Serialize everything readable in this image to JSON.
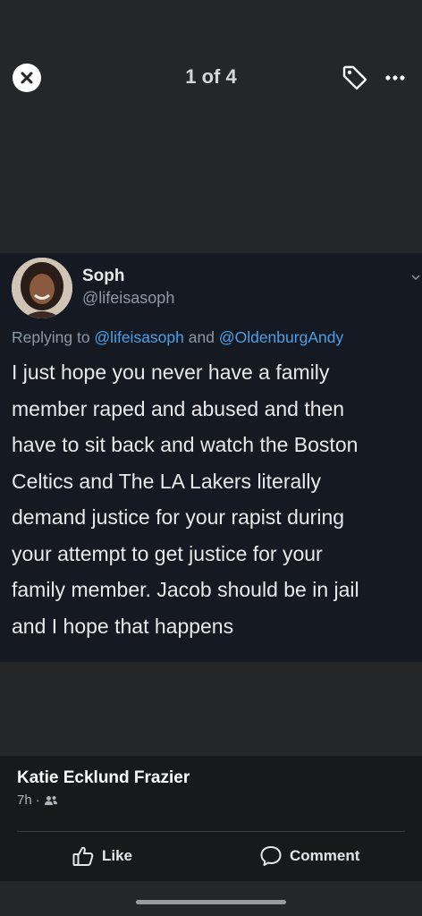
{
  "viewer": {
    "counter": "1 of 4"
  },
  "tweet": {
    "name": "Soph",
    "handle": "@lifeisasoph",
    "reply_prefix": "Replying to ",
    "reply_mention_1": "@lifeisasoph",
    "reply_and": " and ",
    "reply_mention_2": "@OldenburgAndy",
    "body_lines": [
      "I just hope you never have a family",
      "member raped and abused and then",
      "have to sit back and watch the Boston",
      "Celtics and The LA Lakers literally",
      "demand justice for your rapist during",
      "your attempt to get justice for your",
      "family member. Jacob should be in jail",
      "and I hope that happens"
    ]
  },
  "post": {
    "author": "Katie Ecklund Frazier",
    "time": "7h",
    "separator": "·",
    "audience_icon": "friends-icon"
  },
  "actions": {
    "like_label": "Like",
    "comment_label": "Comment"
  },
  "icons": {
    "close": "close-icon",
    "tag": "tag-icon",
    "more": "more-icon",
    "like": "thumbs-up-icon",
    "comment": "comment-icon"
  },
  "colors": {
    "background": "#252627",
    "photo_background": "#151a22",
    "mention": "#4a9fe8",
    "muted": "#8b98a5",
    "bottom_panel": "#18191a"
  }
}
